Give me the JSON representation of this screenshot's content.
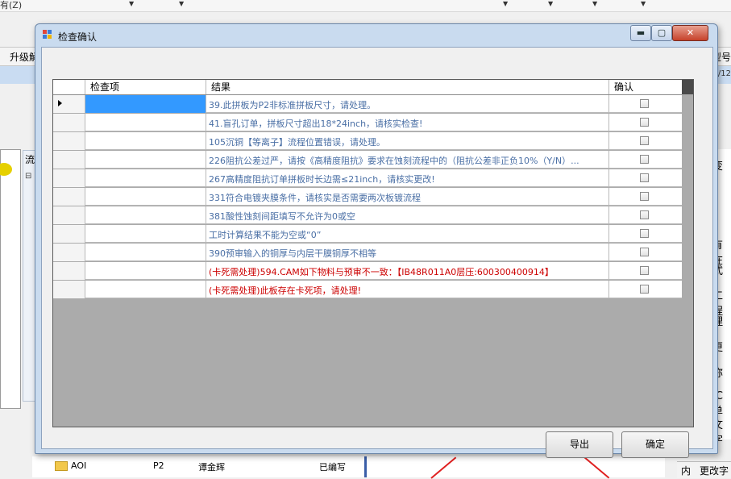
{
  "background": {
    "menu_text": "有(Z)",
    "toolbar_left": "升级解",
    "toolbar_right": "型号",
    "blue_right": "/12",
    "flow_label": "流",
    "flow_minus": "⊟",
    "tree_item": {
      "name": "AOI",
      "layer": "P2",
      "person": "谭金辉",
      "status": "已编写"
    },
    "right_items": [
      "变",
      "有在",
      "式",
      "工程",
      "理",
      "更",
      "称",
      "IC单",
      "文字"
    ],
    "bottom_right_left": "内",
    "bottom_right": "更改字"
  },
  "dialog": {
    "title": "检查确认",
    "window_buttons": {
      "minimize": "▬",
      "maximize": "▢",
      "close": "✕"
    },
    "grid": {
      "columns": [
        "检查项",
        "结果",
        "确认"
      ],
      "rows": [
        {
          "item": "",
          "result": "39.此拼板为P2非标准拼板尺寸，请处理。",
          "color": "#4a6fa5",
          "checked": false
        },
        {
          "item": "",
          "result": "41.盲孔订单，拼板尺寸超出18*24inch，请核实检查!",
          "color": "#4a6fa5",
          "checked": false
        },
        {
          "item": "",
          "result": "105沉铜【等离子】流程位置错误，请处理。",
          "color": "#4a6fa5",
          "checked": false
        },
        {
          "item": "",
          "result": "226阻抗公差过严，请按《高精度阻抗》要求在蚀刻流程中的（阻抗公差非正负10%（Y/N）...",
          "color": "#4a6fa5",
          "checked": false
        },
        {
          "item": "",
          "result": "267高精度阻抗订单拼板时长边需≤21inch，请核实更改!",
          "color": "#4a6fa5",
          "checked": false
        },
        {
          "item": "",
          "result": "331符合电镀夹膜条件，请核实是否需要两次板镀流程",
          "color": "#4a6fa5",
          "checked": false
        },
        {
          "item": "",
          "result": "381酸性蚀刻间距填写不允许为0或空",
          "color": "#4a6fa5",
          "checked": false
        },
        {
          "item": "",
          "result": "工时计算结果不能为空或“0”",
          "color": "#4a6fa5",
          "checked": false
        },
        {
          "item": "",
          "result": "390预审输入的铜厚与内层干膜铜厚不相等",
          "color": "#4a6fa5",
          "checked": false
        },
        {
          "item": "",
          "result": "(卡死需处理)594.CAM如下物料与预审不一致：【IB48R011A0层压:600300400914】",
          "color": "#cc0000",
          "checked": false
        },
        {
          "item": "",
          "result": "(卡死需处理)此板存在卡死项，请处理!",
          "color": "#cc0000",
          "checked": false
        }
      ]
    },
    "buttons": {
      "export": "导出",
      "confirm": "确定"
    }
  }
}
